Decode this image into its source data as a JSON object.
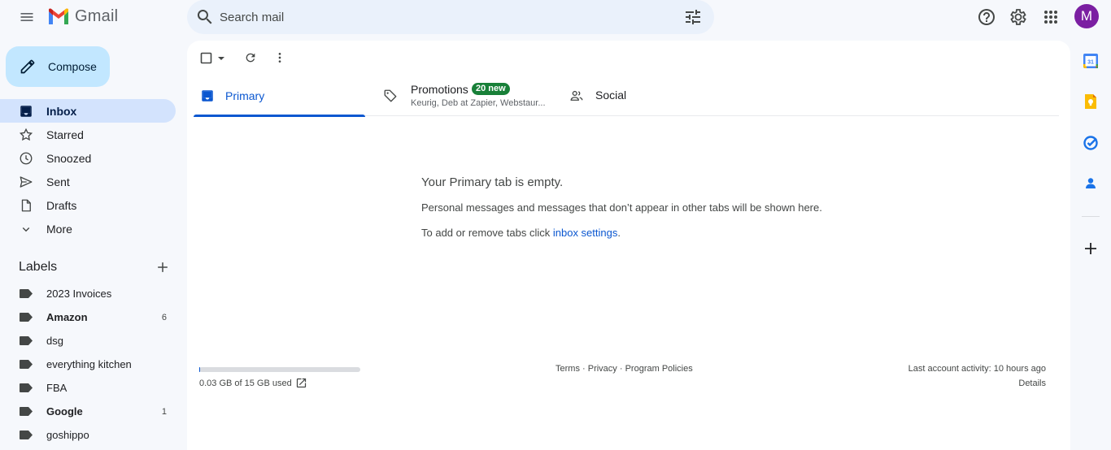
{
  "header": {
    "app_name": "Gmail",
    "search_placeholder": "Search mail",
    "avatar_initial": "M",
    "colors": {
      "avatar": "#7b1fa2",
      "search_bg": "#eaf1fb"
    }
  },
  "compose": {
    "label": "Compose"
  },
  "nav": {
    "items": [
      {
        "label": "Inbox",
        "icon": "inbox-icon",
        "active": true
      },
      {
        "label": "Starred",
        "icon": "star-icon"
      },
      {
        "label": "Snoozed",
        "icon": "clock-icon"
      },
      {
        "label": "Sent",
        "icon": "send-icon"
      },
      {
        "label": "Drafts",
        "icon": "draft-icon"
      },
      {
        "label": "More",
        "icon": "chevron-down-icon"
      }
    ]
  },
  "labels": {
    "title": "Labels",
    "items": [
      {
        "label": "2023 Invoices",
        "count": "",
        "bold": false
      },
      {
        "label": "Amazon",
        "count": "6",
        "bold": true
      },
      {
        "label": "dsg",
        "count": "",
        "bold": false
      },
      {
        "label": "everything kitchen",
        "count": "",
        "bold": false
      },
      {
        "label": "FBA",
        "count": "",
        "bold": false
      },
      {
        "label": "Google",
        "count": "1",
        "bold": true
      },
      {
        "label": "goshippo",
        "count": "",
        "bold": false
      }
    ]
  },
  "tabs": {
    "primary": {
      "label": "Primary"
    },
    "promotions": {
      "label": "Promotions",
      "badge": "20 new",
      "senders": "Keurig, Deb at Zapier, Webstaur..."
    },
    "social": {
      "label": "Social"
    }
  },
  "empty_state": {
    "title": "Your Primary tab is empty.",
    "message": "Personal messages and messages that don’t appear in other tabs will be shown here.",
    "settings_prefix": "To add or remove tabs click ",
    "settings_link": "inbox settings",
    "settings_suffix": "."
  },
  "footer": {
    "storage_text": "0.03 GB of 15 GB used",
    "storage_fraction": 0.002,
    "terms": "Terms",
    "privacy": "Privacy",
    "policies": "Program Policies",
    "separator": " · ",
    "activity": "Last account activity: 10 hours ago",
    "details": "Details"
  },
  "side_panel": {
    "apps": [
      "calendar-icon",
      "keep-icon",
      "tasks-icon",
      "contacts-icon",
      "add-icon"
    ],
    "calendar_day": "31"
  }
}
